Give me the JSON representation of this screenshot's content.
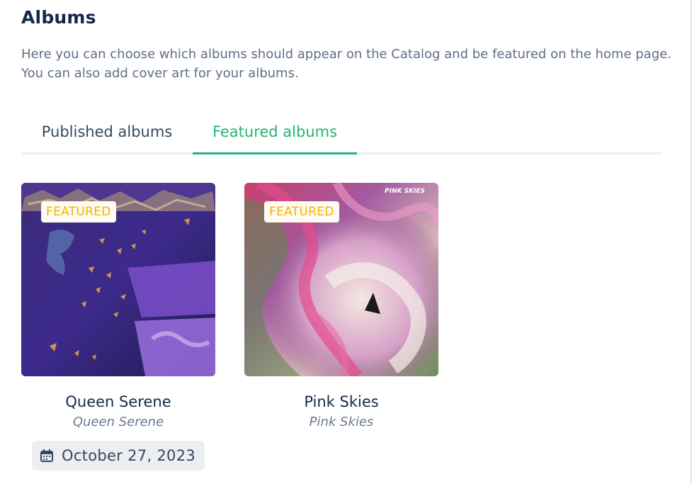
{
  "page": {
    "title": "Albums",
    "description": "Here you can choose which albums should appear on the Catalog and be featured on the home page. You can also add cover art for your albums."
  },
  "tabs": [
    {
      "label": "Published albums",
      "active": false
    },
    {
      "label": "Featured albums",
      "active": true
    }
  ],
  "albums": [
    {
      "title": "Queen Serene",
      "artist": "Queen Serene",
      "badge": "FEATURED",
      "date": "October 27, 2023",
      "cover_icon": "cover-art-purple"
    },
    {
      "title": "Pink Skies",
      "artist": "Pink Skies",
      "badge": "FEATURED",
      "cover_text": "PINK SKIES",
      "cover_icon": "cover-art-psychedelic"
    }
  ],
  "colors": {
    "accent": "#22b573",
    "badge_text": "#f5b400",
    "title": "#16284a"
  }
}
